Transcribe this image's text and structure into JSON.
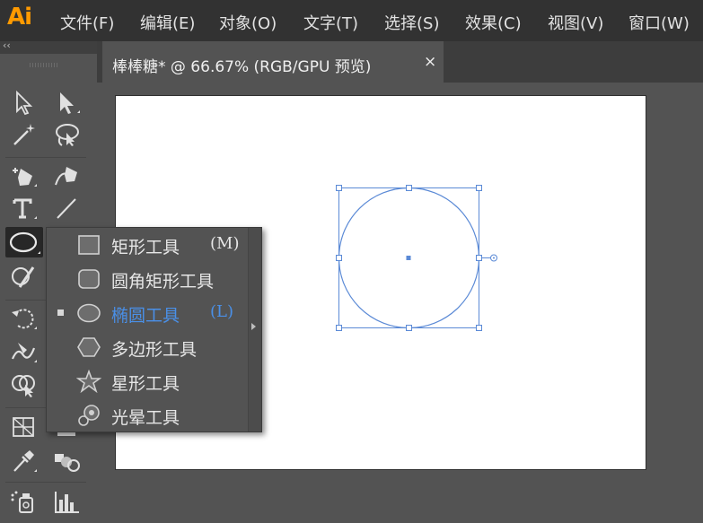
{
  "app": {
    "logo": "Ai"
  },
  "menu": [
    "文件(F)",
    "编辑(E)",
    "对象(O)",
    "文字(T)",
    "选择(S)",
    "效果(C)",
    "视图(V)",
    "窗口(W)"
  ],
  "toolbar": {
    "collapse_glyph": "‹‹"
  },
  "document": {
    "tab_title": "棒棒糖* @ 66.67% (RGB/GPU 预览)",
    "close_glyph": "×"
  },
  "flyout": {
    "items": [
      {
        "label": "矩形工具",
        "shortcut": "(M)",
        "icon": "rectangle-icon",
        "active": false
      },
      {
        "label": "圆角矩形工具",
        "shortcut": "",
        "icon": "rounded-rectangle-icon",
        "active": false
      },
      {
        "label": "椭圆工具",
        "shortcut": "(L)",
        "icon": "ellipse-icon",
        "active": true
      },
      {
        "label": "多边形工具",
        "shortcut": "",
        "icon": "polygon-icon",
        "active": false
      },
      {
        "label": "星形工具",
        "shortcut": "",
        "icon": "star-icon",
        "active": false
      },
      {
        "label": "光晕工具",
        "shortcut": "",
        "icon": "flare-icon",
        "active": false
      }
    ]
  },
  "colors": {
    "accent": "#4a90e8",
    "selection": "#5b8ad6",
    "menubar": "#323232",
    "workspace": "#535353"
  }
}
